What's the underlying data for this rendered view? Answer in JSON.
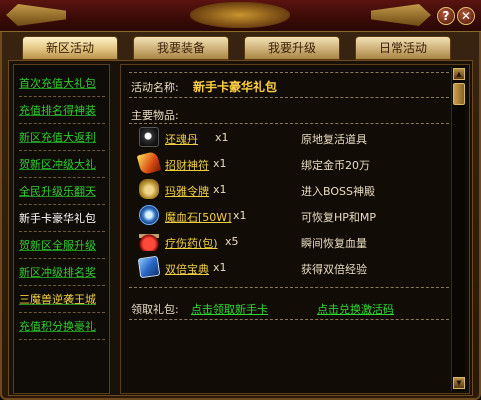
{
  "window": {
    "help_label": "?",
    "close_label": "✕"
  },
  "tabs": [
    {
      "label": "新区活动"
    },
    {
      "label": "我要装备"
    },
    {
      "label": "我要升级"
    },
    {
      "label": "日常活动"
    }
  ],
  "sidebar": {
    "items": [
      {
        "label": "首次充值大礼包"
      },
      {
        "label": "充值排名得神装"
      },
      {
        "label": "新区充值大返利"
      },
      {
        "label": "贺新区冲级大礼"
      },
      {
        "label": "全民升级乐翻天"
      },
      {
        "label": "新手卡豪华礼包"
      },
      {
        "label": "贺新区全服升级"
      },
      {
        "label": "新区冲级排名奖"
      },
      {
        "label": "三魔兽逆袭王城"
      },
      {
        "label": "充值积分换豪礼"
      }
    ]
  },
  "main": {
    "activity_label": "活动名称:",
    "activity_name": "新手卡豪华礼包",
    "items_label": "主要物品:",
    "items": [
      {
        "icon": "pill-icon",
        "name": "还魂丹",
        "qty": "x1",
        "desc": "原地复活道具"
      },
      {
        "icon": "talisman-icon",
        "name": "招财神符",
        "qty": "x1",
        "desc": "绑定金币20万"
      },
      {
        "icon": "scroll-token-icon",
        "name": "玛雅令牌",
        "qty": "x1",
        "desc": "进入BOSS神殿"
      },
      {
        "icon": "stone-icon",
        "name": "魔血石[50W]",
        "qty": "x1",
        "desc": "可恢复HP和MP"
      },
      {
        "icon": "potion-icon",
        "name": "疗伤药(包)",
        "qty": "x5",
        "desc": "瞬间恢复血量"
      },
      {
        "icon": "book-icon",
        "name": "双倍宝典",
        "qty": "x1",
        "desc": "获得双倍经验"
      }
    ],
    "claim_label": "领取礼包:",
    "claim_link_1": "点击领取新手卡",
    "claim_link_2": "点击兑换激活码"
  },
  "scrollbar": {
    "up": "▲",
    "down": "▼"
  }
}
